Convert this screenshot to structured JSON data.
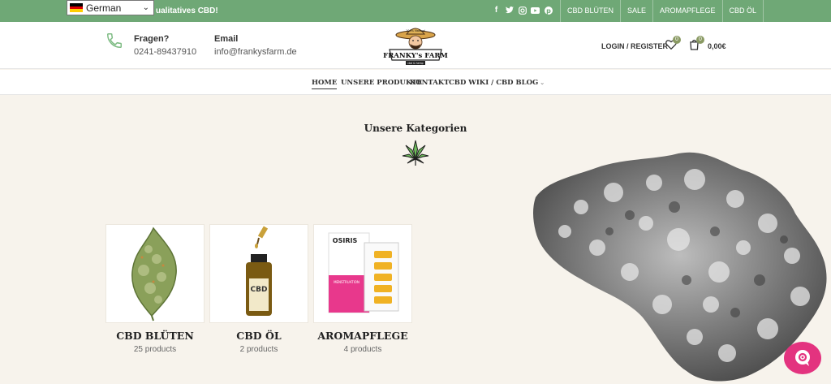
{
  "topbar": {
    "language": "German",
    "promo_text": "ualitatives CBD!",
    "social_icons": [
      "facebook-icon",
      "twitter-icon",
      "instagram-icon",
      "youtube-icon",
      "pinterest-icon"
    ],
    "links": [
      "CBD BLÜTEN",
      "SALE",
      "AROMAPFLEGE",
      "CBD ÖL"
    ],
    "bg_color": "#6fa876"
  },
  "header": {
    "phone_label": "Fragen?",
    "phone_value": "0241-89437910",
    "email_label": "Email",
    "email_value": "info@frankysfarm.de",
    "logo_top": "100% Natural",
    "logo_text": "FRANKY's FARM",
    "logo_sub": "cbd & hemp",
    "login_label": "LOGIN / REGISTER",
    "wishlist_count": "0",
    "cart_count": "0",
    "cart_total": "0,00€"
  },
  "nav": {
    "items": [
      "HOME",
      "UNSERE PRODUKTE",
      "KONTAKT",
      "CBD WIKI / CBD BLOG"
    ],
    "active": "HOME"
  },
  "main": {
    "section_title": "Unsere Kategorien",
    "categories": [
      {
        "title": "CBD BLÜTEN",
        "count": "25 products"
      },
      {
        "title": "CBD ÖL",
        "count": "2 products"
      },
      {
        "title": "AROMAPFLEGE",
        "count": "4 products"
      }
    ],
    "bottle_label": "CBD",
    "box_brand": "OSIRIS",
    "box_product": "MENSTRUATION"
  },
  "colors": {
    "accent_green": "#6fa876",
    "badge_olive": "#8a9a63",
    "chat_pink": "#e3337f",
    "page_bg": "#f7f3ec"
  }
}
